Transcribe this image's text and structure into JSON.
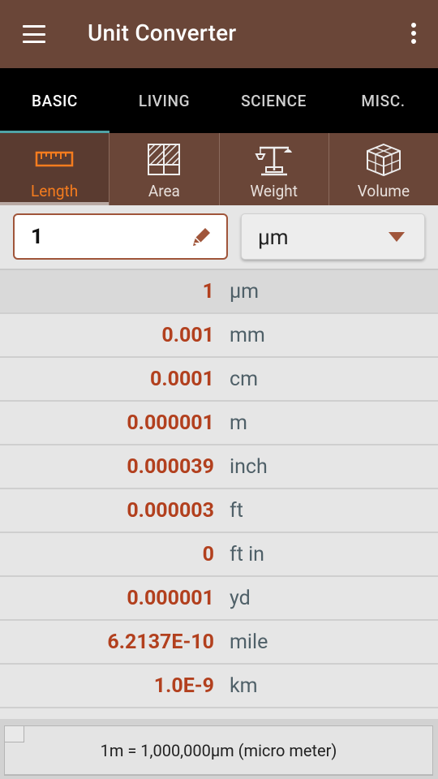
{
  "app": {
    "title": "Unit Converter"
  },
  "tabs": [
    {
      "label": "BASIC",
      "active": true
    },
    {
      "label": "LIVING",
      "active": false
    },
    {
      "label": "SCIENCE",
      "active": false
    },
    {
      "label": "MISC.",
      "active": false
    }
  ],
  "categories": [
    {
      "label": "Length",
      "icon": "ruler-icon",
      "active": true
    },
    {
      "label": "Area",
      "icon": "area-grid-icon",
      "active": false
    },
    {
      "label": "Weight",
      "icon": "scale-icon",
      "active": false
    },
    {
      "label": "Volume",
      "icon": "cube-icon",
      "active": false
    }
  ],
  "input": {
    "value": "1",
    "unit": "μm"
  },
  "results": [
    {
      "value": "1",
      "unit": "μm"
    },
    {
      "value": "0.001",
      "unit": "mm"
    },
    {
      "value": "0.0001",
      "unit": "cm"
    },
    {
      "value": "0.000001",
      "unit": "m"
    },
    {
      "value": "0.000039",
      "unit": "inch"
    },
    {
      "value": "0.000003",
      "unit": "ft"
    },
    {
      "value": "0",
      "unit": "ft in"
    },
    {
      "value": "0.000001",
      "unit": "yd"
    },
    {
      "value": "6.2137E-10",
      "unit": "mile"
    },
    {
      "value": "1.0E-9",
      "unit": "km"
    }
  ],
  "footer": {
    "info": "1m = 1,000,000μm (micro meter)"
  },
  "colors": {
    "primary": "#6a4638",
    "accent": "#f57c1e",
    "value": "#b2401e",
    "tab_indicator": "#4fa3a6"
  }
}
